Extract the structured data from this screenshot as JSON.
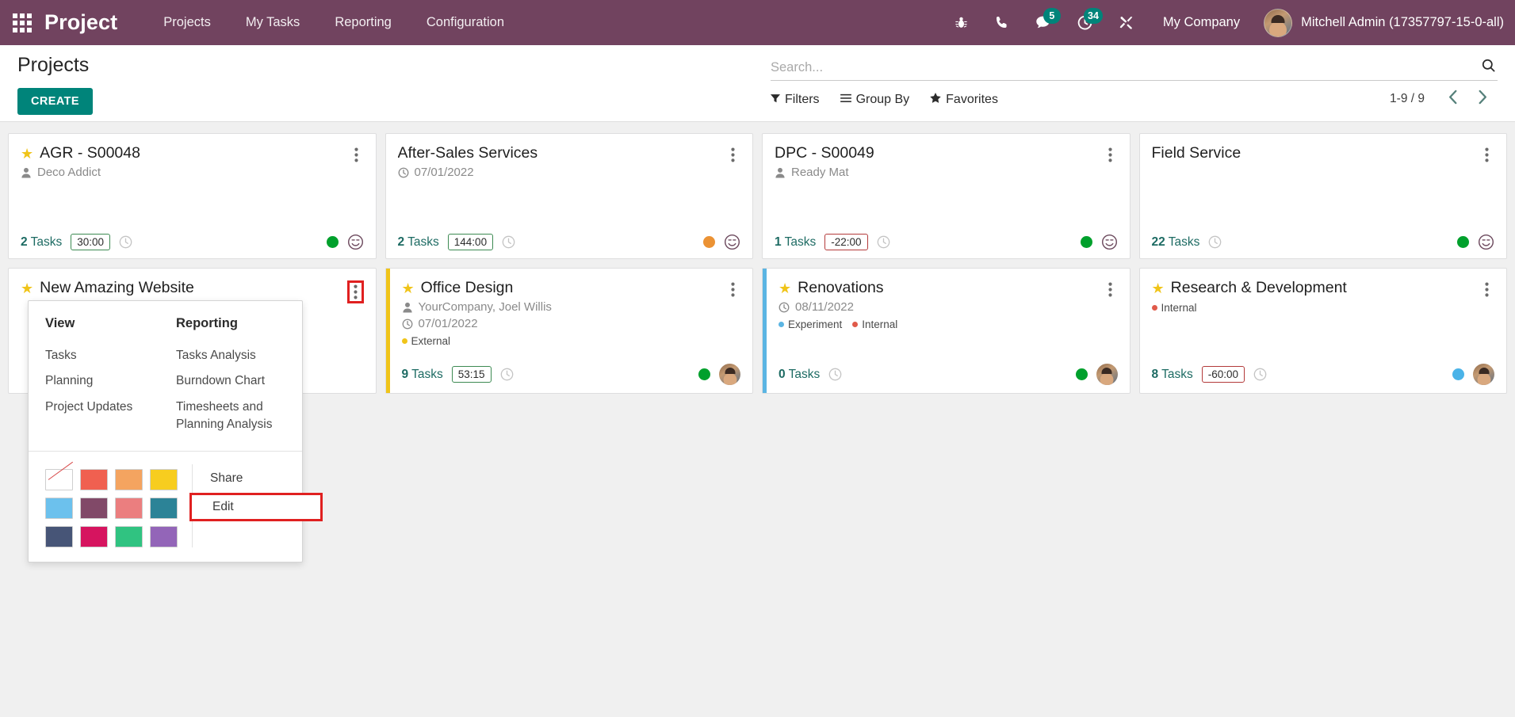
{
  "navbar": {
    "apps_icon": "apps-grid-icon",
    "brand": "Project",
    "menu": [
      {
        "label": "Projects"
      },
      {
        "label": "My Tasks"
      },
      {
        "label": "Reporting"
      },
      {
        "label": "Configuration"
      }
    ],
    "sysicons": [
      {
        "name": "bug-icon",
        "badge": ""
      },
      {
        "name": "phone-icon",
        "badge": ""
      },
      {
        "name": "messages-icon",
        "badge": "5"
      },
      {
        "name": "activities-clock-icon",
        "badge": "34"
      },
      {
        "name": "tools-icon",
        "badge": ""
      }
    ],
    "company": "My Company",
    "user": "Mitchell Admin (17357797-15-0-all)",
    "accent": "#71435f",
    "badge_color": "#00847a"
  },
  "control_panel": {
    "title": "Projects",
    "create_label": "CREATE",
    "search": {
      "placeholder": "Search...",
      "value": ""
    },
    "search_icon": "search-icon",
    "filters": [
      {
        "label": "Filters",
        "icon": "filter-icon"
      },
      {
        "label": "Group By",
        "icon": "group-by-icon"
      },
      {
        "label": "Favorites",
        "icon": "star-icon"
      }
    ],
    "pager": {
      "text": "1-9 / 9",
      "prev": "chevron-left-icon",
      "next": "chevron-right-icon"
    }
  },
  "kanban": {
    "cards": [
      {
        "title": "AGR - S00048",
        "favorite": true,
        "partner": "Deco Addict",
        "date": "",
        "tags": [],
        "stripe": "",
        "tasks_count": "2",
        "tasks_label": "Tasks",
        "hours": "30:00",
        "hours_negative": false,
        "status_dot": "#00a02c",
        "trailing": "smiley",
        "menu_highlight": false
      },
      {
        "title": "After-Sales Services",
        "favorite": false,
        "partner": "",
        "date": "07/01/2022",
        "tags": [],
        "stripe": "",
        "tasks_count": "2",
        "tasks_label": "Tasks",
        "hours": "144:00",
        "hours_negative": false,
        "status_dot": "#eb9234",
        "trailing": "smiley",
        "menu_highlight": false
      },
      {
        "title": "DPC - S00049",
        "favorite": false,
        "partner": "Ready Mat",
        "date": "",
        "tags": [],
        "stripe": "",
        "tasks_count": "1",
        "tasks_label": "Tasks",
        "hours": "-22:00",
        "hours_negative": true,
        "status_dot": "#00a02c",
        "trailing": "smiley",
        "menu_highlight": false
      },
      {
        "title": "Field Service",
        "favorite": false,
        "partner": "",
        "date": "",
        "tags": [],
        "stripe": "",
        "tasks_count": "22",
        "tasks_label": "Tasks",
        "hours": "",
        "hours_negative": false,
        "status_dot": "#00a02c",
        "trailing": "smiley",
        "menu_highlight": false
      },
      {
        "title": "New Amazing Website",
        "favorite": true,
        "partner": "",
        "date": "",
        "tags": [],
        "stripe": "",
        "tasks_count": "",
        "tasks_label": "",
        "hours": "",
        "hours_negative": false,
        "status_dot": "",
        "trailing": "",
        "menu_highlight": true
      },
      {
        "title": "Office Design",
        "favorite": true,
        "partner": "YourCompany, Joel Willis",
        "date": "07/01/2022",
        "tags": [
          {
            "label": "External",
            "color": "#f0c419"
          }
        ],
        "stripe": "#f0c419",
        "tasks_count": "9",
        "tasks_label": "Tasks",
        "hours": "53:15",
        "hours_negative": false,
        "status_dot": "#00a02c",
        "trailing": "avatar",
        "menu_highlight": false
      },
      {
        "title": "Renovations",
        "favorite": true,
        "partner": "",
        "date": "08/11/2022",
        "tags": [
          {
            "label": "Experiment",
            "color": "#5bb5e3"
          },
          {
            "label": "Internal",
            "color": "#e05a4a"
          }
        ],
        "stripe": "#5bb5e3",
        "tasks_count": "0",
        "tasks_label": "Tasks",
        "hours": "",
        "hours_negative": false,
        "status_dot": "#00a02c",
        "trailing": "avatar",
        "menu_highlight": false
      },
      {
        "title": "Research & Development",
        "favorite": true,
        "partner": "",
        "date": "",
        "tags": [
          {
            "label": "Internal",
            "color": "#e05a4a"
          }
        ],
        "stripe": "",
        "tasks_count": "8",
        "tasks_label": "Tasks",
        "hours": "-60:00",
        "hours_negative": true,
        "status_dot": "#4ab3e8",
        "trailing": "avatar",
        "menu_highlight": false
      }
    ]
  },
  "dropdown": {
    "view_title": "View",
    "view_links": [
      {
        "label": "Tasks"
      },
      {
        "label": "Planning"
      },
      {
        "label": "Project Updates"
      }
    ],
    "reporting_title": "Reporting",
    "reporting_links": [
      {
        "label": "Tasks Analysis"
      },
      {
        "label": "Burndown Chart"
      },
      {
        "label": "Timesheets and Planning Analysis"
      }
    ],
    "colors": [
      {
        "name": "no-color",
        "hex": ""
      },
      {
        "name": "red",
        "hex": "#f06050"
      },
      {
        "name": "orange",
        "hex": "#f4a460"
      },
      {
        "name": "yellow",
        "hex": "#f7cd1f"
      },
      {
        "name": "light-blue",
        "hex": "#6cc1ed"
      },
      {
        "name": "dark-purple",
        "hex": "#814968"
      },
      {
        "name": "salmon-pink",
        "hex": "#eb7e7f"
      },
      {
        "name": "teal",
        "hex": "#2c8397"
      },
      {
        "name": "dark-blue",
        "hex": "#475577"
      },
      {
        "name": "fuchsia",
        "hex": "#d6145f"
      },
      {
        "name": "green",
        "hex": "#30c381"
      },
      {
        "name": "purple",
        "hex": "#9365b8"
      }
    ],
    "actions": [
      {
        "label": "Share",
        "highlight": false
      },
      {
        "label": "Edit",
        "highlight": true
      }
    ]
  }
}
